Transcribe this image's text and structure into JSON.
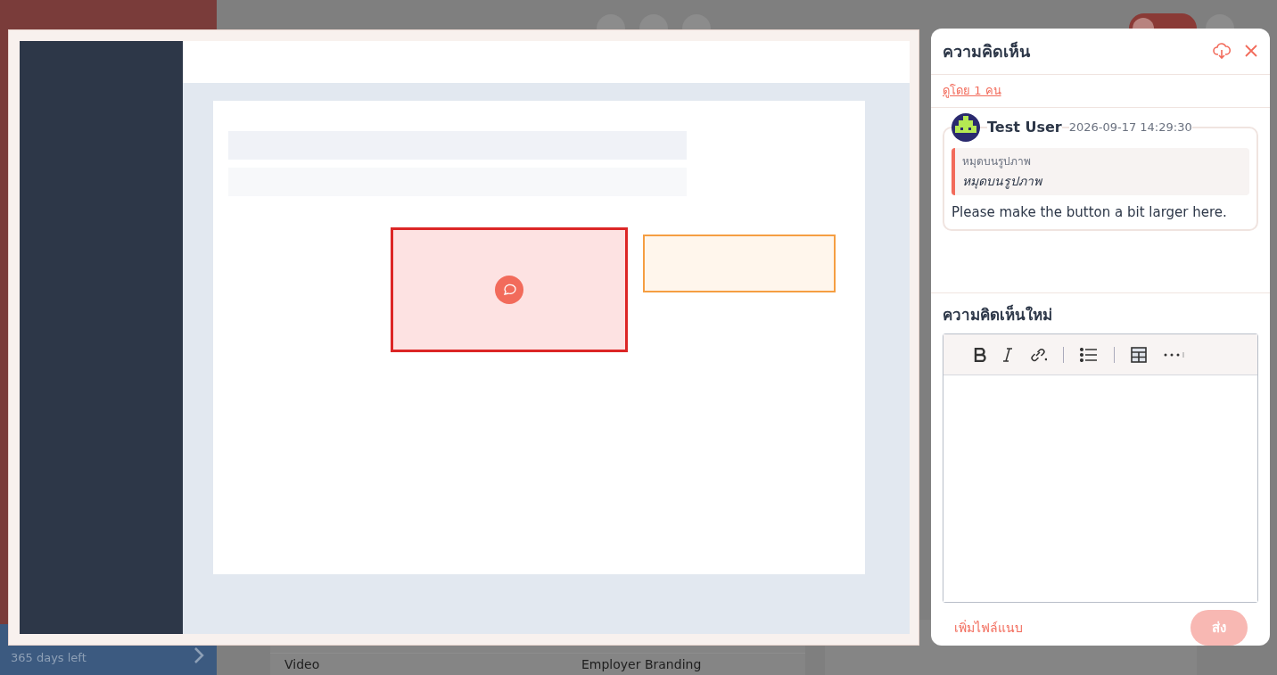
{
  "background": {
    "sidebar": {
      "trial": "365 days left"
    },
    "table_row": [
      "Video",
      "Employer Branding"
    ]
  },
  "viewer": {
    "annotations": [
      {
        "selected": true,
        "comment": true
      },
      {
        "selected": false,
        "comment": false
      }
    ]
  },
  "comments_panel": {
    "title": "ความคิดเห็น",
    "viewers_link": "ดูโดย 1 คน",
    "comments": [
      {
        "author": "Test User",
        "time": "2026-09-17 14:29:30",
        "quote_label": "หมุดบนรูปภาพ",
        "quote": "หมุดบนรูปภาพ",
        "text": "Please make the button a bit larger here."
      }
    ],
    "new_comment": {
      "title": "ความคิดเห็นใหม่",
      "attach": "เพิ่มไฟล์แนบ",
      "send": {
        "label": "ส่ง",
        "disabled": true
      }
    }
  }
}
